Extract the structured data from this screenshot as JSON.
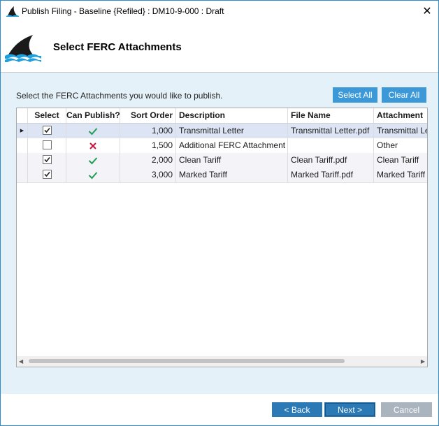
{
  "window": {
    "title": "Publish Filing - Baseline {Refiled} : DM10-9-000 : Draft",
    "close_glyph": "✕"
  },
  "header": {
    "title": "Select FERC Attachments",
    "logo_icon": "shark-fin-logo-icon"
  },
  "content": {
    "instruction": "Select the FERC Attachments you would like to publish.",
    "select_all_label": "Select All",
    "clear_all_label": "Clear All"
  },
  "grid": {
    "columns": [
      "Select",
      "Can Publish?",
      "Sort Order",
      "Description",
      "File Name",
      "Attachment"
    ],
    "rows": [
      {
        "selected": true,
        "can_publish": true,
        "sort_order": "1,000",
        "description": "Transmittal Letter",
        "file_name": "Transmittal Letter.pdf",
        "attachment": "Transmittal Letter"
      },
      {
        "selected": false,
        "can_publish": false,
        "sort_order": "1,500",
        "description": "Additional FERC Attachment",
        "file_name": "",
        "attachment": "Other"
      },
      {
        "selected": true,
        "can_publish": true,
        "sort_order": "2,000",
        "description": "Clean Tariff",
        "file_name": "Clean Tariff.pdf",
        "attachment": "Clean Tariff"
      },
      {
        "selected": true,
        "can_publish": true,
        "sort_order": "3,000",
        "description": "Marked Tariff",
        "file_name": "Marked Tariff.pdf",
        "attachment": "Marked Tariff"
      }
    ]
  },
  "footer": {
    "back_label": "< Back",
    "next_label": "Next >",
    "cancel_label": "Cancel"
  },
  "colors": {
    "accent": "#3d98d8",
    "nav_button": "#2b79b5",
    "cancel_disabled": "#a9b4bf",
    "check_green": "#1f9d55",
    "cross_red": "#d0103a",
    "panel_bg": "#e4f1f9"
  }
}
